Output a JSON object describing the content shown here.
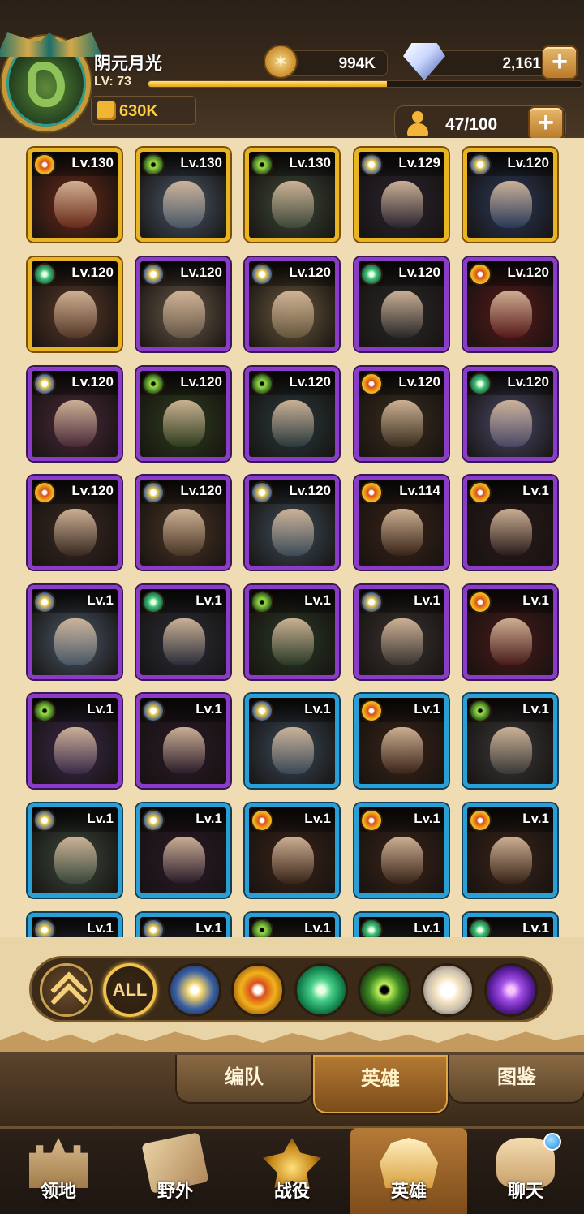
{
  "player": {
    "name": "阴元月光",
    "level_label": "LV: 73",
    "xp_progress": 0.55,
    "power": "630K"
  },
  "resources": {
    "gold": "994K",
    "diamonds": "2,161"
  },
  "hero_capacity": "47/100",
  "factions_colors": {
    "gold_frame": "#e8b420",
    "purple_frame": "#8a3cc9",
    "blue_frame": "#2a9fd6"
  },
  "heroes": [
    {
      "level": "Lv.130",
      "frame": "gold",
      "faction": "mauler",
      "tint": "#6b2a18"
    },
    {
      "level": "Lv.130",
      "frame": "gold",
      "faction": "grave",
      "tint": "#4a5a6a"
    },
    {
      "level": "Lv.130",
      "frame": "gold",
      "faction": "grave",
      "tint": "#3e4a3a"
    },
    {
      "level": "Lv.129",
      "frame": "gold",
      "faction": "light",
      "tint": "#2a2430"
    },
    {
      "level": "Lv.120",
      "frame": "gold",
      "faction": "light",
      "tint": "#2a3a5a"
    },
    {
      "level": "Lv.120",
      "frame": "gold",
      "faction": "wilder",
      "tint": "#5a3a2a"
    },
    {
      "level": "Lv.120",
      "frame": "purple",
      "faction": "light",
      "tint": "#6a5a4a"
    },
    {
      "level": "Lv.120",
      "frame": "purple",
      "faction": "light",
      "tint": "#6a5a3e"
    },
    {
      "level": "Lv.120",
      "frame": "purple",
      "faction": "wilder",
      "tint": "#2a2a2a"
    },
    {
      "level": "Lv.120",
      "frame": "purple",
      "faction": "mauler",
      "tint": "#5a1a1a"
    },
    {
      "level": "Lv.120",
      "frame": "purple",
      "faction": "light",
      "tint": "#4a2a3a"
    },
    {
      "level": "Lv.120",
      "frame": "purple",
      "faction": "grave",
      "tint": "#2e3e1e"
    },
    {
      "level": "Lv.120",
      "frame": "purple",
      "faction": "grave",
      "tint": "#2a3a3e"
    },
    {
      "level": "Lv.120",
      "frame": "purple",
      "faction": "mauler",
      "tint": "#3a2e1e"
    },
    {
      "level": "Lv.120",
      "frame": "purple",
      "faction": "wilder",
      "tint": "#4a4a6a"
    },
    {
      "level": "Lv.120",
      "frame": "purple",
      "faction": "mauler",
      "tint": "#3a2a22"
    },
    {
      "level": "Lv.120",
      "frame": "purple",
      "faction": "light",
      "tint": "#4a3626"
    },
    {
      "level": "Lv.120",
      "frame": "purple",
      "faction": "light",
      "tint": "#3e4e5a"
    },
    {
      "level": "Lv.114",
      "frame": "purple",
      "faction": "mauler",
      "tint": "#3a2418"
    },
    {
      "level": "Lv.1",
      "frame": "purple",
      "faction": "mauler",
      "tint": "#2a1a1a"
    },
    {
      "level": "Lv.1",
      "frame": "purple",
      "faction": "light",
      "tint": "#4a5a6a"
    },
    {
      "level": "Lv.1",
      "frame": "purple",
      "faction": "wilder",
      "tint": "#2a2e3a"
    },
    {
      "level": "Lv.1",
      "frame": "purple",
      "faction": "grave",
      "tint": "#2a3a26"
    },
    {
      "level": "Lv.1",
      "frame": "purple",
      "faction": "light",
      "tint": "#3a3430"
    },
    {
      "level": "Lv.1",
      "frame": "purple",
      "faction": "mauler",
      "tint": "#4a1a1a"
    },
    {
      "level": "Lv.1",
      "frame": "purple",
      "faction": "grave",
      "tint": "#3a2a4a"
    },
    {
      "level": "Lv.1",
      "frame": "purple",
      "faction": "light",
      "tint": "#2a1a2a"
    },
    {
      "level": "Lv.1",
      "frame": "blue",
      "faction": "light",
      "tint": "#3a4a5a"
    },
    {
      "level": "Lv.1",
      "frame": "blue",
      "faction": "mauler",
      "tint": "#3a2418"
    },
    {
      "level": "Lv.1",
      "frame": "blue",
      "faction": "grave",
      "tint": "#3a3a3a"
    },
    {
      "level": "Lv.1",
      "frame": "blue",
      "faction": "light",
      "tint": "#3a4a3e"
    },
    {
      "level": "Lv.1",
      "frame": "blue",
      "faction": "light",
      "tint": "#2a1a2a"
    },
    {
      "level": "Lv.1",
      "frame": "blue",
      "faction": "mauler",
      "tint": "#3a2418"
    },
    {
      "level": "Lv.1",
      "frame": "blue",
      "faction": "mauler",
      "tint": "#3a2418"
    },
    {
      "level": "Lv.1",
      "frame": "blue",
      "faction": "mauler",
      "tint": "#3a2418"
    },
    {
      "level": "Lv.1",
      "frame": "blue",
      "faction": "light",
      "tint": "#3a4a5a"
    },
    {
      "level": "Lv.1",
      "frame": "blue",
      "faction": "light",
      "tint": "#3a3a4a"
    },
    {
      "level": "Lv.1",
      "frame": "blue",
      "faction": "grave",
      "tint": "#3a3a3a"
    },
    {
      "level": "Lv.1",
      "frame": "blue",
      "faction": "wilder",
      "tint": "#2a3a3a"
    },
    {
      "level": "Lv.1",
      "frame": "blue",
      "faction": "wilder",
      "tint": "#3a3a3a"
    }
  ],
  "filters": [
    {
      "id": "up",
      "label": "",
      "icon": "chevron-up-icon"
    },
    {
      "id": "all",
      "label": "ALL",
      "icon": "all-filter"
    },
    {
      "id": "light",
      "label": "",
      "icon": "lightbearer-icon"
    },
    {
      "id": "mauler",
      "label": "",
      "icon": "mauler-icon"
    },
    {
      "id": "wilder",
      "label": "",
      "icon": "wilder-icon"
    },
    {
      "id": "grave",
      "label": "",
      "icon": "graveborn-icon"
    },
    {
      "id": "celest",
      "label": "",
      "icon": "celestial-icon"
    },
    {
      "id": "hyp",
      "label": "",
      "icon": "hypogean-icon"
    }
  ],
  "subtabs": [
    {
      "label": "编队",
      "active": false
    },
    {
      "label": "英雄",
      "active": true
    },
    {
      "label": "图鉴",
      "active": false
    }
  ],
  "nav": [
    {
      "label": "领地",
      "icon": "castle",
      "active": false
    },
    {
      "label": "野外",
      "icon": "scroll",
      "active": false
    },
    {
      "label": "战役",
      "icon": "sword",
      "active": false
    },
    {
      "label": "英雄",
      "icon": "helm",
      "active": true
    },
    {
      "label": "聊天",
      "icon": "chat",
      "active": false
    }
  ]
}
